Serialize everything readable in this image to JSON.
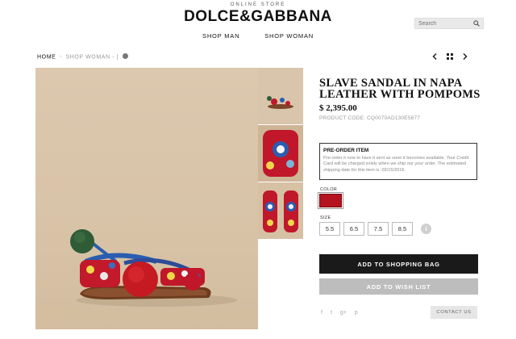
{
  "header": {
    "tagline": "ONLINE STORE",
    "brand": "DOLCE&GABBANA",
    "nav": [
      "SHOP MAN",
      "SHOP WOMAN"
    ],
    "search_placeholder": "Search"
  },
  "breadcrumb": {
    "home": "HOME",
    "sep": "-",
    "section": "SHOP WOMAN",
    "tail": "- |"
  },
  "product": {
    "title": "SLAVE SANDAL IN NAPA LEATHER WITH POMPOMS",
    "price": "$ 2,395.00",
    "code": "PRODUCT CODE: CQ0070AD130E5877",
    "preorder_heading": "PRE-ORDER ITEM",
    "preorder_body": "Pre-order it now to have it sent as soon it becomes available. Your Credit Card will be charged solely when we ship our your order. The estimated shipping date for this item is: 03/15/2016.",
    "color_label": "COLOR",
    "color_swatch": "#b3141f",
    "size_label": "SIZE",
    "sizes": [
      "5.5",
      "6.5",
      "7.5",
      "8.5"
    ],
    "info_glyph": "i"
  },
  "actions": {
    "add_to_bag": "ADD TO SHOPPING BAG",
    "add_to_wishlist": "ADD TO WISH LIST",
    "contact": "CONTACT US"
  },
  "social": [
    "f",
    "t",
    "g+",
    "p"
  ],
  "icons": {
    "search": "search-icon",
    "prev": "chevron-left-icon",
    "grid": "grid-icon",
    "next": "chevron-right-icon"
  },
  "colors": {
    "primary_button": "#1a1a1a",
    "secondary_button": "#bdbdbd",
    "swatch": "#b3141f"
  }
}
